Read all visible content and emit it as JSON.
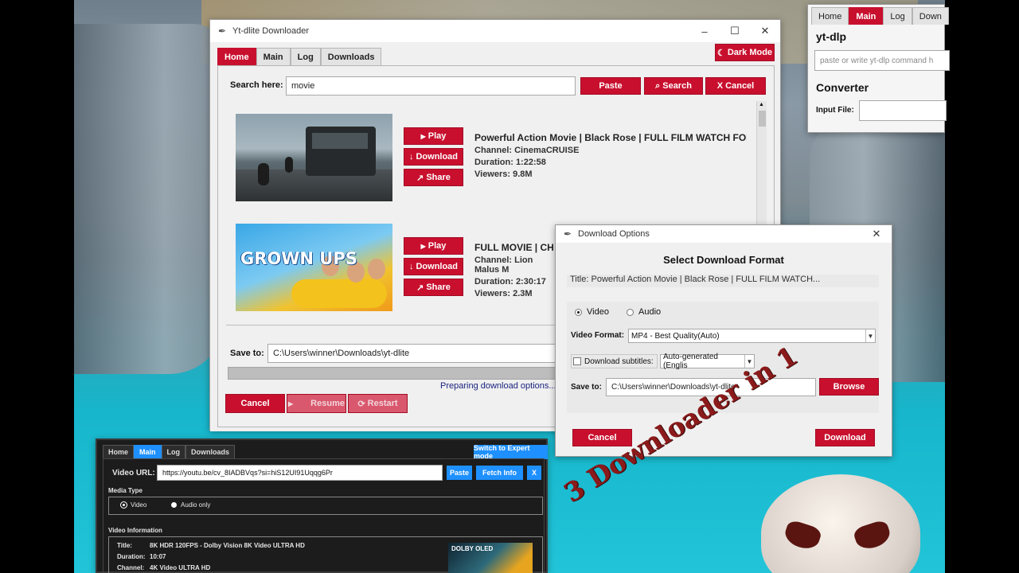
{
  "main_window": {
    "title": "Yt-dlite Downloader",
    "tabs": [
      "Home",
      "Main",
      "Log",
      "Downloads"
    ],
    "dark_mode_label": "Dark Mode",
    "search_label": "Search here:",
    "search_value": "movie",
    "paste_label": "Paste",
    "search_button_label": "Search",
    "cancel_search_label": "X Cancel",
    "results": [
      {
        "title": "Powerful Action Movie | Black Rose | FULL FILM WATCH FOR FR",
        "channel": "Channel: CinemaCRUISE",
        "duration": "Duration: 1:22:58",
        "viewers": "Viewers: 9.8M",
        "play": "Play",
        "download": "Download",
        "share": "Share"
      },
      {
        "title": "FULL MOVIE | CHIL",
        "channel": "Channel: Lion Malus M",
        "duration": "Duration: 2:30:17",
        "viewers": "Viewers: 2.3M",
        "thumb_text": "GROWN UPS",
        "play": "Play",
        "download": "Download",
        "share": "Share"
      }
    ],
    "save_to_label": "Save to:",
    "save_to_value": "C:\\Users\\winner\\Downloads\\yt-dlite",
    "status": "Preparing download options...",
    "cancel_label": "Cancel",
    "resume_label": "Resume",
    "restart_label": "Restart"
  },
  "dialog": {
    "title": "Download Options",
    "heading": "Select Download Format",
    "video_title": "Title: Powerful Action Movie | Black Rose | FULL FILM WATCH...",
    "video_label": "Video",
    "audio_label": "Audio",
    "video_format_label": "Video Format:",
    "video_format_value": "MP4 - Best Quality(Auto)",
    "subtitles_label": "Download subtitles:",
    "subtitles_value": "Auto-generated (Englis",
    "save_to_label": "Save to:",
    "save_to_value": "C:\\Users\\winner\\Downloads\\yt-dlite",
    "browse_label": "Browse",
    "cancel_label": "Cancel",
    "download_label": "Download"
  },
  "topright_window": {
    "tabs": [
      "Home",
      "Main",
      "Log",
      "Down"
    ],
    "heading": "yt-dlp",
    "command_placeholder": "paste or write yt-dlp command h",
    "converter_heading": "Converter",
    "input_file_label": "Input File:"
  },
  "dark_window": {
    "tabs": [
      "Home",
      "Main",
      "Log",
      "Downloads"
    ],
    "expert_label": "Switch to Expert mode",
    "url_label": "Video URL:",
    "url_value": "https://youtu.be/cv_8IADBVqs?si=hiS12UI91Uqqg6Pr",
    "paste_label": "Paste",
    "fetch_label": "Fetch Info",
    "close_label": "X",
    "media_type_label": "Media Type",
    "video_label": "Video",
    "audio_only_label": "Audio only",
    "video_info_label": "Video Information",
    "info_title_label": "Title:",
    "info_title_value": "8K HDR 120FPS - Dolby Vision 8K Video ULTRA HD",
    "info_duration_label": "Duration:",
    "info_duration_value": "10:07",
    "info_channel_label": "Channel:",
    "info_channel_value": "4K Video ULTRA HD",
    "thumb_brand": "DOLBY OLED"
  },
  "overlay": {
    "headline": "3 Downloader in 1"
  },
  "colors": {
    "accent_red": "#c8102e",
    "accent_blue": "#1e90ff"
  }
}
